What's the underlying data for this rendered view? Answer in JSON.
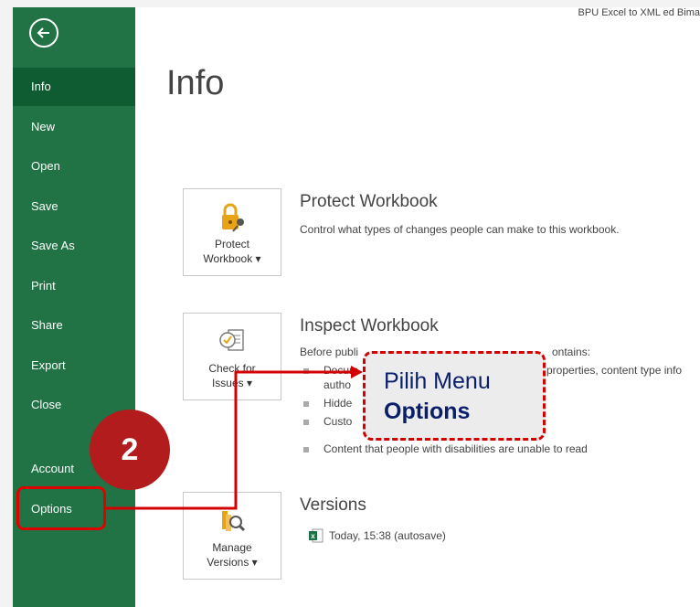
{
  "window": {
    "file_title": "BPU Excel to XML ed Bima"
  },
  "sidebar": {
    "items": [
      {
        "label": "Info"
      },
      {
        "label": "New"
      },
      {
        "label": "Open"
      },
      {
        "label": "Save"
      },
      {
        "label": "Save As"
      },
      {
        "label": "Print"
      },
      {
        "label": "Share"
      },
      {
        "label": "Export"
      },
      {
        "label": "Close"
      },
      {
        "label": "Account"
      },
      {
        "label": "Options"
      }
    ]
  },
  "main": {
    "title": "Info",
    "protect": {
      "button_line1": "Protect",
      "button_line2": "Workbook ▾",
      "heading": "Protect Workbook",
      "desc": "Control what types of changes people can make to this workbook."
    },
    "inspect": {
      "button_line1": "Check for",
      "button_line2": "Issues ▾",
      "heading": "Inspect Workbook",
      "desc": "Before publi",
      "desc_tail": "ontains:",
      "bullets": [
        {
          "text": "Docum",
          "tail": "properties, content type info"
        },
        {
          "text": "autho",
          "tail": ""
        },
        {
          "text": "Hidde",
          "tail": ""
        },
        {
          "text": "Custo",
          "tail": ""
        },
        {
          "text": "Content that people with disabilities are unable to read",
          "tail": ""
        }
      ]
    },
    "versions": {
      "button_line1": "Manage",
      "button_line2": "Versions ▾",
      "heading": "Versions",
      "entry": "Today, 15:38 (autosave)"
    }
  },
  "annotation": {
    "callout_line1": "Pilih Menu",
    "callout_line2": "Options",
    "step_number": "2",
    "color": "#d40000"
  }
}
